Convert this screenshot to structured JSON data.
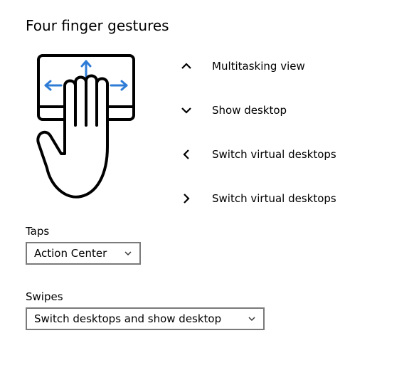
{
  "section": {
    "title": "Four finger gestures"
  },
  "gestures": {
    "up": {
      "label": "Multitasking view"
    },
    "down": {
      "label": "Show desktop"
    },
    "left": {
      "label": "Switch virtual desktops"
    },
    "right": {
      "label": "Switch virtual desktops"
    }
  },
  "taps": {
    "label": "Taps",
    "selected": "Action Center"
  },
  "swipes": {
    "label": "Swipes",
    "selected": "Switch desktops and show desktop"
  }
}
